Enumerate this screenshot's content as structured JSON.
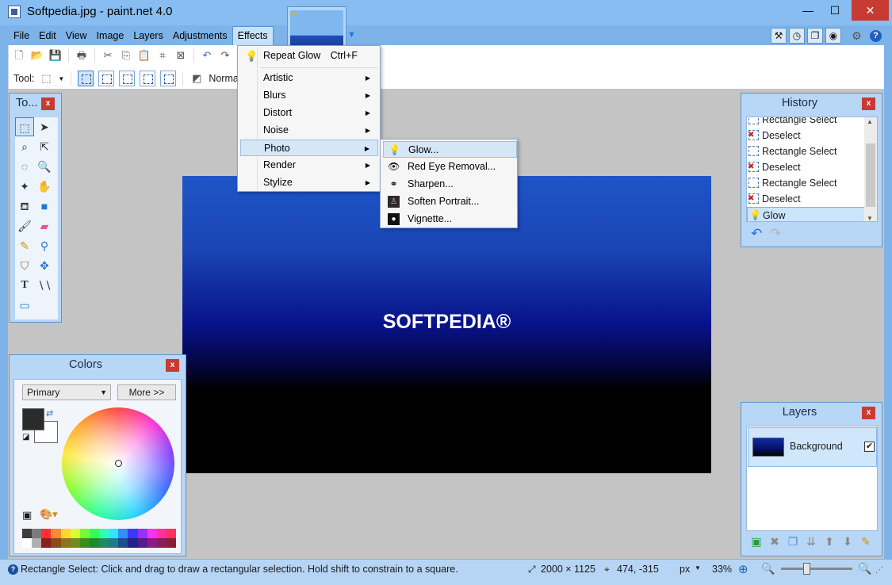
{
  "window": {
    "title": "Softpedia.jpg - paint.net 4.0",
    "min_glyph": "—",
    "max_glyph": "☐",
    "close_glyph": "✕"
  },
  "menubar": {
    "items": [
      {
        "label": "File"
      },
      {
        "label": "Edit"
      },
      {
        "label": "View"
      },
      {
        "label": "Image"
      },
      {
        "label": "Layers"
      },
      {
        "label": "Adjustments"
      },
      {
        "label": "Effects"
      }
    ]
  },
  "toolbar": {
    "tool_label": "Tool:",
    "blend_mode": "Normal"
  },
  "effects_menu": {
    "repeat_label": "Repeat Glow",
    "repeat_shortcut": "Ctrl+F",
    "items": [
      {
        "label": "Artistic"
      },
      {
        "label": "Blurs"
      },
      {
        "label": "Distort"
      },
      {
        "label": "Noise"
      },
      {
        "label": "Photo"
      },
      {
        "label": "Render"
      },
      {
        "label": "Stylize"
      }
    ]
  },
  "photo_menu": {
    "items": [
      {
        "label": "Glow..."
      },
      {
        "label": "Red Eye Removal..."
      },
      {
        "label": "Sharpen..."
      },
      {
        "label": "Soften Portrait..."
      },
      {
        "label": "Vignette..."
      }
    ]
  },
  "canvas": {
    "logo_text": "SOFTPEDIA®"
  },
  "tools_panel": {
    "title": "To..."
  },
  "colors_panel": {
    "title": "Colors",
    "mode": "Primary",
    "more_label": "More >>",
    "primary_color": "#2b2b2b",
    "secondary_color": "#ffffff",
    "palette_top": [
      "#3d3d3d",
      "#7b7b7b",
      "#ff3030",
      "#ff8a2a",
      "#ffd630",
      "#d8ff30",
      "#74ff30",
      "#30ff56",
      "#30ffb6",
      "#30e6ff",
      "#3090ff",
      "#3a3aff",
      "#9a30ff",
      "#ff30f0",
      "#ff30a0",
      "#ff3060"
    ],
    "palette_bottom": [
      "#ffffff",
      "#b0b0b0",
      "#8a1d1d",
      "#8a4a1a",
      "#8a741d",
      "#738a1d",
      "#3f8a1d",
      "#1d8a2f",
      "#1d8a62",
      "#1d7c8a",
      "#1d4e8a",
      "#22228a",
      "#531d8a",
      "#8a1d82",
      "#8a1d57",
      "#8a1d34"
    ]
  },
  "history_panel": {
    "title": "History",
    "items": [
      {
        "label": "Rectangle Select",
        "kind": "select"
      },
      {
        "label": "Deselect",
        "kind": "deselect"
      },
      {
        "label": "Rectangle Select",
        "kind": "select"
      },
      {
        "label": "Deselect",
        "kind": "deselect"
      },
      {
        "label": "Rectangle Select",
        "kind": "select"
      },
      {
        "label": "Deselect",
        "kind": "deselect"
      },
      {
        "label": "Glow",
        "kind": "glow"
      }
    ]
  },
  "layers_panel": {
    "title": "Layers",
    "layer_name": "Background",
    "visible_mark": "✔"
  },
  "statusbar": {
    "text": "Rectangle Select: Click and drag to draw a rectangular selection. Hold shift to constrain to a square.",
    "image_size": "2000 × 1125",
    "cursor_position": "474, -315",
    "units": "px",
    "zoom": "33%"
  },
  "colors": {
    "accent": "#1f79d1",
    "close_red": "#c83b32"
  }
}
